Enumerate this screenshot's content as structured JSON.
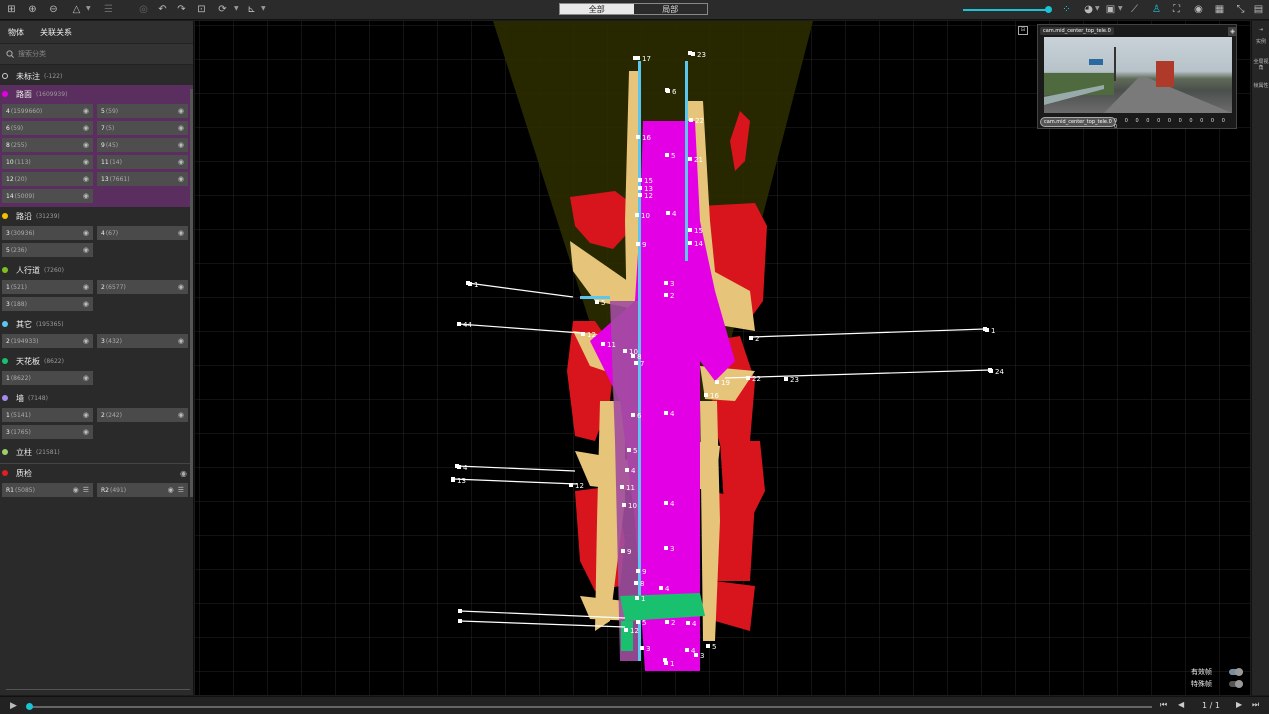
{
  "toolbar": {
    "view_all": "全部",
    "view_local": "局部",
    "icons_left": [
      "grid-icon",
      "add-icon",
      "remove-icon",
      "shape-icon",
      "layers-icon",
      "circle-icon",
      "undo-icon",
      "redo-icon",
      "fit-icon",
      "rotate-icon",
      "axis-icon"
    ],
    "icons_right": [
      "points-icon",
      "palette-icon",
      "display-icon",
      "ruler-icon",
      "person-icon",
      "fullscreen-icon",
      "target-icon",
      "calendar-icon",
      "shrink-icon",
      "save-icon"
    ],
    "accent_color": "#19c4d4"
  },
  "left_panel": {
    "tab_objects": "物体",
    "tab_relations": "关联关系",
    "search_placeholder": "搜索分类",
    "unlabeled": {
      "name": "未标注",
      "count": "(-122)"
    },
    "categories": [
      {
        "name": "路面",
        "count": "(1609939)",
        "color": "#e400e4",
        "highlight": true,
        "items": [
          [
            "4",
            "(1599660)"
          ],
          [
            "5",
            "(59)"
          ],
          [
            "6",
            "(59)"
          ],
          [
            "7",
            "(5)"
          ],
          [
            "8",
            "(255)"
          ],
          [
            "9",
            "(45)"
          ],
          [
            "10",
            "(113)"
          ],
          [
            "11",
            "(14)"
          ],
          [
            "12",
            "(20)"
          ],
          [
            "13",
            "(7661)"
          ],
          [
            "14",
            "(5009)"
          ]
        ]
      },
      {
        "name": "路沿",
        "count": "(31239)",
        "color": "#f2c200",
        "items": [
          [
            "3",
            "(30936)"
          ],
          [
            "4",
            "(67)"
          ],
          [
            "5",
            "(236)"
          ]
        ]
      },
      {
        "name": "人行道",
        "count": "(7260)",
        "color": "#7cc21e",
        "items": [
          [
            "1",
            "(521)"
          ],
          [
            "2",
            "(6577)"
          ],
          [
            "3",
            "(188)"
          ]
        ]
      },
      {
        "name": "其它",
        "count": "(195365)",
        "color": "#5bc6f0",
        "items": [
          [
            "2",
            "(194933)"
          ],
          [
            "3",
            "(432)"
          ]
        ]
      },
      {
        "name": "天花板",
        "count": "(8622)",
        "color": "#19c06e",
        "items": [
          [
            "1",
            "(8622)"
          ]
        ]
      },
      {
        "name": "墙",
        "count": "(7148)",
        "color": "#a78af0",
        "items": [
          [
            "1",
            "(5141)"
          ],
          [
            "2",
            "(242)"
          ],
          [
            "3",
            "(1765)"
          ]
        ]
      },
      {
        "name": "立柱",
        "count": "(21581)",
        "color": "#9ad06a",
        "items": []
      }
    ],
    "qa": {
      "name": "质检",
      "color": "#e02020",
      "items": [
        [
          "R1",
          "(5085)"
        ],
        [
          "R2",
          "(491)"
        ]
      ]
    }
  },
  "viewport": {
    "camera_name": "cam.mid_center_top_tele.0",
    "camera_button": "cam.mid_center_top_tele.0",
    "camera_values": "0 0 0 0 0 0 0 0 0 0 0 0",
    "valid_frames": "有效帧",
    "special_frames": "特殊帧",
    "valid_frames_on": true,
    "special_frames_on": false,
    "lane_labels": [
      {
        "t": "17"
      },
      {
        "t": "23"
      },
      {
        "t": "6"
      },
      {
        "t": "22"
      },
      {
        "t": "16"
      },
      {
        "t": "5"
      },
      {
        "t": "21"
      },
      {
        "t": "15"
      },
      {
        "t": "13"
      },
      {
        "t": "12"
      },
      {
        "t": "10"
      },
      {
        "t": "4"
      },
      {
        "t": "15"
      },
      {
        "t": "9"
      },
      {
        "t": "14"
      },
      {
        "t": "3"
      },
      {
        "t": "2"
      },
      {
        "t": "1"
      },
      {
        "t": "5"
      },
      {
        "t": "44"
      },
      {
        "t": "12"
      },
      {
        "t": "11"
      },
      {
        "t": "10"
      },
      {
        "t": "8"
      },
      {
        "t": "7"
      },
      {
        "t": "1"
      },
      {
        "t": "2"
      },
      {
        "t": "23"
      },
      {
        "t": "22"
      },
      {
        "t": "24"
      },
      {
        "t": "19"
      },
      {
        "t": "16"
      },
      {
        "t": "6"
      },
      {
        "t": "4"
      },
      {
        "t": "5"
      },
      {
        "t": "4"
      },
      {
        "t": "4"
      },
      {
        "t": "13"
      },
      {
        "t": "12"
      },
      {
        "t": "11"
      },
      {
        "t": "10"
      },
      {
        "t": "4"
      },
      {
        "t": "9"
      },
      {
        "t": "3"
      },
      {
        "t": "9"
      },
      {
        "t": "8"
      },
      {
        "t": "1"
      },
      {
        "t": "4"
      },
      {
        "t": "5"
      },
      {
        "t": "2"
      },
      {
        "t": "4"
      },
      {
        "t": "12"
      },
      {
        "t": "3"
      },
      {
        "t": "4"
      },
      {
        "t": "1"
      },
      {
        "t": "5"
      },
      {
        "t": "3"
      }
    ]
  },
  "right_rail": {
    "item1": "实例",
    "item2": "全局视角",
    "item3": "帧属性"
  },
  "timeline": {
    "page": "1 / 1",
    "progress": 0
  }
}
